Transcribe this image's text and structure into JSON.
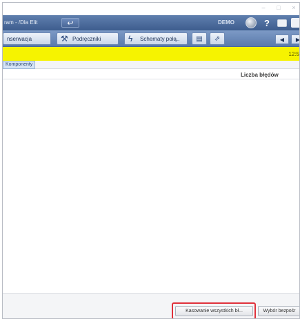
{
  "app": {
    "title": "ram - /Dla Elit",
    "demo_label": "DEMO"
  },
  "toolbar": {
    "tab1_label": "nserwacja",
    "tab2_label": "Podręczniki",
    "tab3_label": "Schematy połą..",
    "time": "12:5"
  },
  "components": {
    "tab_label": "Komponenty",
    "column_header": "Liczba błędów"
  },
  "buttons": {
    "reset_label": "Kasowanie wszystkich bł...",
    "select_label": "Wybór bezpośr"
  },
  "colors": {
    "header_blue": "#3e5d8e",
    "status_yellow": "#f6f300",
    "highlight_red": "#e0303a"
  }
}
